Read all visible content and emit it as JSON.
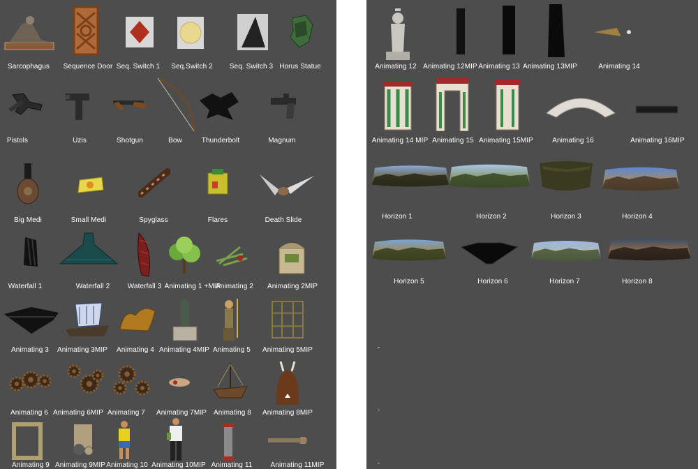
{
  "panels": [
    {
      "id": "left",
      "items": [
        {
          "label": "Sarcophagus",
          "icon": "sarcophagus-icon"
        },
        {
          "label": "Sequence Door",
          "icon": "sequence-door-icon"
        },
        {
          "label": "Seq. Switch 1",
          "icon": "seq-switch-1-icon"
        },
        {
          "label": "Seq.Switch 2",
          "icon": "seq-switch-2-icon"
        },
        {
          "label": "Seq. Switch 3",
          "icon": "seq-switch-3-icon"
        },
        {
          "label": "Horus Statue",
          "icon": "horus-statue-icon"
        },
        {
          "label": "Pistols",
          "icon": "pistols-icon"
        },
        {
          "label": "Uzis",
          "icon": "uzis-icon"
        },
        {
          "label": "Shotgun",
          "icon": "shotgun-icon"
        },
        {
          "label": "Bow",
          "icon": "bow-icon"
        },
        {
          "label": "Thunderbolt",
          "icon": "thunderbolt-icon"
        },
        {
          "label": "Magnum",
          "icon": "magnum-icon"
        },
        {
          "label": "Big Medi",
          "icon": "big-medi-icon"
        },
        {
          "label": "Small Medi",
          "icon": "small-medi-icon"
        },
        {
          "label": "Spyglass",
          "icon": "spyglass-icon"
        },
        {
          "label": "Flares",
          "icon": "flares-icon"
        },
        {
          "label": "Death Slide",
          "icon": "death-slide-icon"
        },
        {
          "label": "Waterfall 1",
          "icon": "waterfall-1-icon"
        },
        {
          "label": "Waterfall 2",
          "icon": "waterfall-2-icon"
        },
        {
          "label": "Waterfall 3",
          "icon": "waterfall-3-icon"
        },
        {
          "label": "Animating 1 +MIP",
          "icon": "animating-1-mip-icon"
        },
        {
          "label": "Animating 2",
          "icon": "animating-2-icon"
        },
        {
          "label": "Animating 2MIP",
          "icon": "animating-2mip-icon"
        },
        {
          "label": "Animating 3",
          "icon": "animating-3-icon"
        },
        {
          "label": "Animating 3MIP",
          "icon": "animating-3mip-icon"
        },
        {
          "label": "Animating 4",
          "icon": "animating-4-icon"
        },
        {
          "label": "Animating 4MIP",
          "icon": "animating-4mip-icon"
        },
        {
          "label": "Animating 5",
          "icon": "animating-5-icon"
        },
        {
          "label": "Animating  5MIP",
          "icon": "animating-5mip-icon"
        },
        {
          "label": "Animating 6",
          "icon": "animating-6-icon"
        },
        {
          "label": "Animating 6MIP",
          "icon": "animating-6mip-icon"
        },
        {
          "label": "Animating 7",
          "icon": "animating-7-icon"
        },
        {
          "label": "Animating 7MIP",
          "icon": "animating-7mip-icon"
        },
        {
          "label": "Animating 8",
          "icon": "animating-8-icon"
        },
        {
          "label": "Animating  8MIP",
          "icon": "animating-8mip-icon"
        },
        {
          "label": "Animating 9",
          "icon": "animating-9-icon"
        },
        {
          "label": "Animating 9MIP",
          "icon": "animating-9mip-icon"
        },
        {
          "label": "Animating 10",
          "icon": "animating-10-icon"
        },
        {
          "label": "Animating 10MIP",
          "icon": "animating-10mip-icon"
        },
        {
          "label": "Animating 11",
          "icon": "animating-11-icon"
        },
        {
          "label": "Animating  11MIP",
          "icon": "animating-11mip-icon"
        }
      ]
    },
    {
      "id": "right",
      "items": [
        {
          "label": "Animating 12",
          "icon": "animating-12-icon"
        },
        {
          "label": "Animating 12MIP",
          "icon": "animating-12mip-icon"
        },
        {
          "label": "Animating 13",
          "icon": "animating-13-icon"
        },
        {
          "label": "Animating 13MIP",
          "icon": "animating-13mip-icon"
        },
        {
          "label": "Animating 14",
          "icon": "animating-14-icon"
        },
        {
          "label": "Animating 14 MIP",
          "icon": "animating-14-mip-icon"
        },
        {
          "label": "Animating 15",
          "icon": "animating-15-icon"
        },
        {
          "label": "Animating 15MIP",
          "icon": "animating-15mip-icon"
        },
        {
          "label": "Animating 16",
          "icon": "animating-16-icon"
        },
        {
          "label": "Animating 16MIP",
          "icon": "animating-16mip-icon"
        },
        {
          "label": "Horizon 1",
          "icon": "horizon-1-icon"
        },
        {
          "label": "Horizon 2",
          "icon": "horizon-2-icon"
        },
        {
          "label": "Horizon 3",
          "icon": "horizon-3-icon"
        },
        {
          "label": "Horizon 4",
          "icon": "horizon-4-icon"
        },
        {
          "label": "Horizon 5",
          "icon": "horizon-5-icon"
        },
        {
          "label": "Horizon 6",
          "icon": "horizon-6-icon"
        },
        {
          "label": "Horizon 7",
          "icon": "horizon-7-icon"
        },
        {
          "label": "Horizon 8",
          "icon": "horizon-8-icon"
        }
      ]
    }
  ],
  "colors": {
    "panel_bg": "#4d4d4d",
    "page_bg": "#ffffff",
    "label_text": "#ffffff"
  }
}
